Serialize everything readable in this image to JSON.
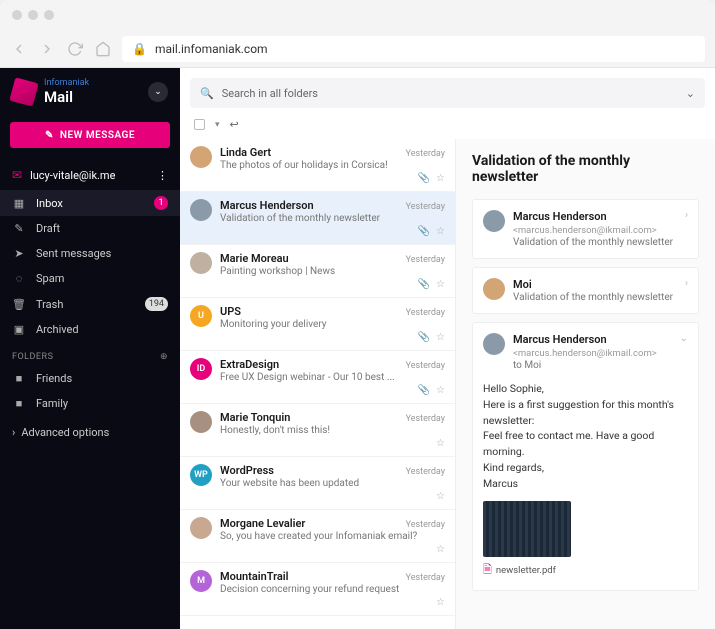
{
  "url": "mail.infomaniak.com",
  "brand": {
    "sub": "Infomaniak",
    "main": "Mail"
  },
  "compose": "NEW MESSAGE",
  "account": "lucy-vitale@ik.me",
  "nav": {
    "inbox": "Inbox",
    "inbox_count": "1",
    "draft": "Draft",
    "sent": "Sent messages",
    "spam": "Spam",
    "trash": "Trash",
    "trash_count": "194",
    "archived": "Archived"
  },
  "folders_label": "FOLDERS",
  "folders": {
    "friends": "Friends",
    "family": "Family"
  },
  "advanced": "Advanced options",
  "search_placeholder": "Search in all folders",
  "messages": [
    {
      "sender": "Linda Gert",
      "subject": "The photos of our holidays in Corsica!",
      "time": "Yesterday",
      "attach": true,
      "avatar": "img",
      "color": "#d4a574",
      "initials": ""
    },
    {
      "sender": "Marcus Henderson",
      "subject": "Validation of the monthly newsletter",
      "time": "Yesterday",
      "attach": true,
      "avatar": "img",
      "color": "#8a9aa8",
      "initials": "",
      "selected": true
    },
    {
      "sender": "Marie Moreau",
      "subject": "Painting workshop | News",
      "time": "Yesterday",
      "attach": true,
      "avatar": "img",
      "color": "#c0b0a0",
      "initials": ""
    },
    {
      "sender": "UPS",
      "subject": "Monitoring your delivery",
      "time": "Yesterday",
      "attach": true,
      "avatar": "init",
      "color": "#f5a623",
      "initials": "U"
    },
    {
      "sender": "ExtraDesign",
      "subject": "Free UX Design webinar - Our 10 best ...",
      "time": "Yesterday",
      "attach": true,
      "avatar": "init",
      "color": "#e6007a",
      "initials": "ID"
    },
    {
      "sender": "Marie Tonquin",
      "subject": "Honestly, don't miss this!",
      "time": "Yesterday",
      "attach": false,
      "avatar": "img",
      "color": "#a89080",
      "initials": ""
    },
    {
      "sender": "WordPress",
      "subject": "Your website has been updated",
      "time": "Yesterday",
      "attach": false,
      "avatar": "init",
      "color": "#21a0c4",
      "initials": "WP"
    },
    {
      "sender": "Morgane Levalier",
      "subject": "So, you have created your Infomaniak email?",
      "time": "Yesterday",
      "attach": false,
      "avatar": "img",
      "color": "#c8a890",
      "initials": ""
    },
    {
      "sender": "MountainTrail",
      "subject": "Decision concerning your refund request",
      "time": "Yesterday",
      "attach": false,
      "avatar": "init",
      "color": "#b464d8",
      "initials": "M"
    }
  ],
  "reader": {
    "title": "Validation of the monthly newsletter",
    "thread": [
      {
        "name": "Marcus Henderson",
        "email": "<marcus.henderson@ikmail.com>",
        "sub": "Validation of the monthly newsletter",
        "color": "#8a9aa8"
      },
      {
        "name": "Moi",
        "email": "",
        "sub": "Validation of the monthly newsletter",
        "color": "#d4a574"
      },
      {
        "name": "Marcus Henderson",
        "email": "<marcus.henderson@ikmail.com>",
        "sub": "to Moi",
        "color": "#8a9aa8"
      }
    ],
    "body": {
      "l1": "Hello Sophie,",
      "l2": "Here is a first suggestion for this month's newsletter:",
      "l3": "Feel free to contact me. Have a good morning.",
      "l4": "Kind regards,",
      "l5": "Marcus"
    },
    "attachment": "newsletter.pdf"
  }
}
